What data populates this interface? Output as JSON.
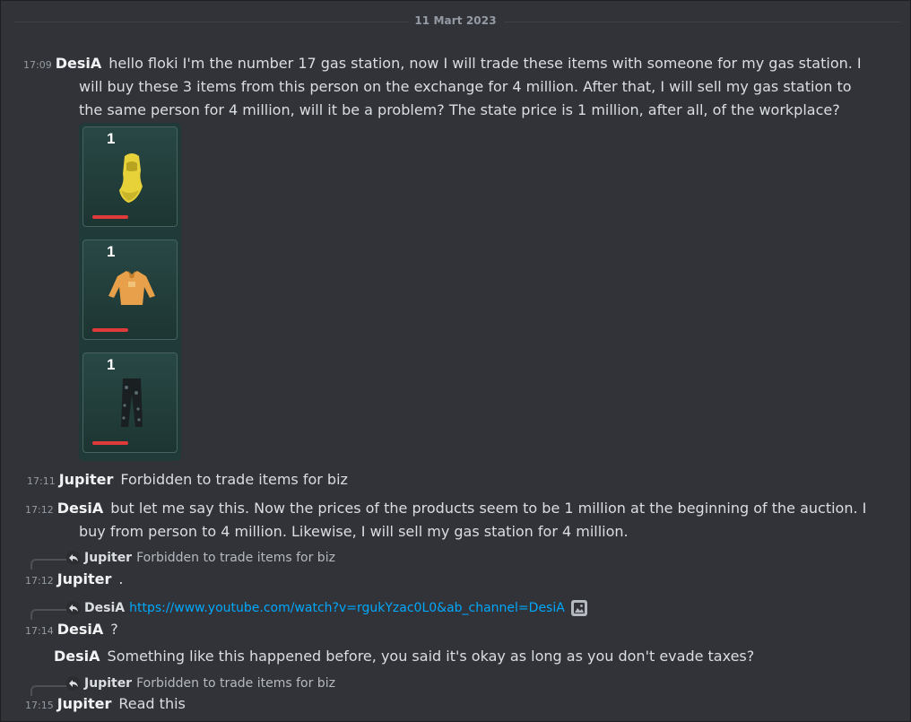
{
  "date_divider": "11 Mart 2023",
  "messages": [
    {
      "time": "17:09",
      "author": "DesiA",
      "lines": [
        "hello floki I'm the number 17 gas station, now I will trade these items with someone for my gas station. I",
        "will buy these 3 items from this person on the exchange for 4 million. After that, I will sell my gas station to",
        "the same person for 4 million, will it be a problem? The state price is 1 million, after all, of the workplace?"
      ],
      "attachment": {
        "slots": [
          {
            "count": "1",
            "item_icon": "yellow-balaclava-icon",
            "color": "#e8d23a"
          },
          {
            "count": "1",
            "item_icon": "orange-jacket-icon",
            "color": "#e8a14a"
          },
          {
            "count": "1",
            "item_icon": "dark-camo-pants-icon",
            "color": "#1a1f22"
          }
        ],
        "bar_color": "#e03a3a"
      }
    },
    {
      "time": "17:11",
      "author": "Jupiter",
      "lines": [
        "Forbidden to trade items for biz"
      ]
    },
    {
      "time": "17:12",
      "author": "DesiA",
      "lines": [
        "but let me say this. Now the prices of the products seem to be 1 million at the beginning of the auction. I",
        "buy from person to 4 million. Likewise, I will sell my gas station for 4 million."
      ]
    },
    {
      "reply": {
        "author": "Jupiter",
        "text": "Forbidden to trade items for biz"
      },
      "time": "17:12",
      "author": "Jupiter",
      "lines": [
        "."
      ]
    },
    {
      "reply": {
        "author": "DesiA",
        "link": "https://www.youtube.com/watch?v=rgukYzac0L0&ab_channel=DesiA",
        "image_icon": "image-icon"
      },
      "time": "17:14",
      "author": "DesiA",
      "lines": [
        "?"
      ]
    },
    {
      "author": "DesiA",
      "lines": [
        "Something like this happened before, you said it's okay as long as you don't evade taxes?"
      ]
    },
    {
      "reply": {
        "author": "Jupiter",
        "text": "Forbidden to trade items for biz"
      },
      "time": "17:15",
      "author": "Jupiter",
      "lines": [
        "Read this"
      ]
    }
  ],
  "colors": {
    "background": "#313338",
    "author": "#f2f3f5",
    "text": "#dbdee1",
    "muted": "#949ba4",
    "link": "#00a8fc",
    "inventory_bg": "#1f3a38"
  }
}
